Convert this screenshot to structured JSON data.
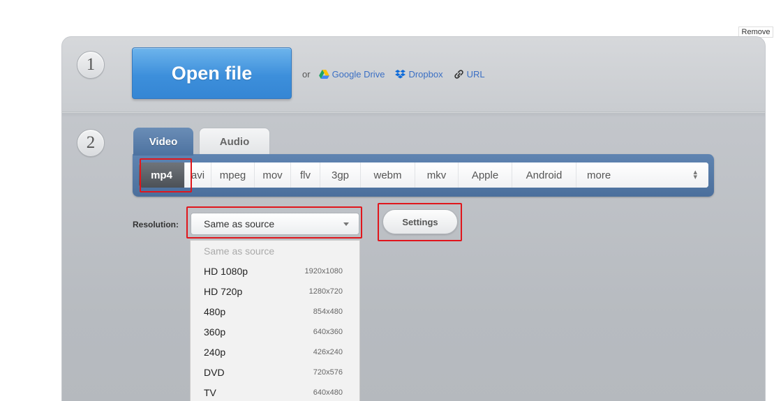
{
  "remove_label": "Remove",
  "step1": {
    "number": "1",
    "open_file_label": "Open file",
    "or_text": "or",
    "sources": [
      {
        "label": "Google Drive",
        "icon": "google-drive-icon"
      },
      {
        "label": "Dropbox",
        "icon": "dropbox-icon"
      },
      {
        "label": "URL",
        "icon": "link-icon"
      }
    ]
  },
  "step2": {
    "number": "2",
    "tabs": [
      {
        "label": "Video",
        "active": true
      },
      {
        "label": "Audio",
        "active": false
      }
    ],
    "formats": [
      "mp4",
      "avi",
      "mpeg",
      "mov",
      "flv",
      "3gp",
      "webm",
      "mkv",
      "Apple",
      "Android",
      "more"
    ],
    "selected_format": "mp4",
    "resolution_label": "Resolution:",
    "resolution_value": "Same as source",
    "settings_label": "Settings",
    "resolution_options": [
      {
        "name": "Same as source",
        "res": ""
      },
      {
        "name": "HD 1080p",
        "res": "1920x1080"
      },
      {
        "name": "HD 720p",
        "res": "1280x720"
      },
      {
        "name": "480p",
        "res": "854x480"
      },
      {
        "name": "360p",
        "res": "640x360"
      },
      {
        "name": "240p",
        "res": "426x240"
      },
      {
        "name": "DVD",
        "res": "720x576"
      },
      {
        "name": "TV",
        "res": "640x480"
      }
    ]
  },
  "colors": {
    "accent_blue": "#3d8fdb",
    "tab_blue": "#5f84b1",
    "highlight_red": "#e0161c",
    "link_blue": "#3b6fc4"
  }
}
